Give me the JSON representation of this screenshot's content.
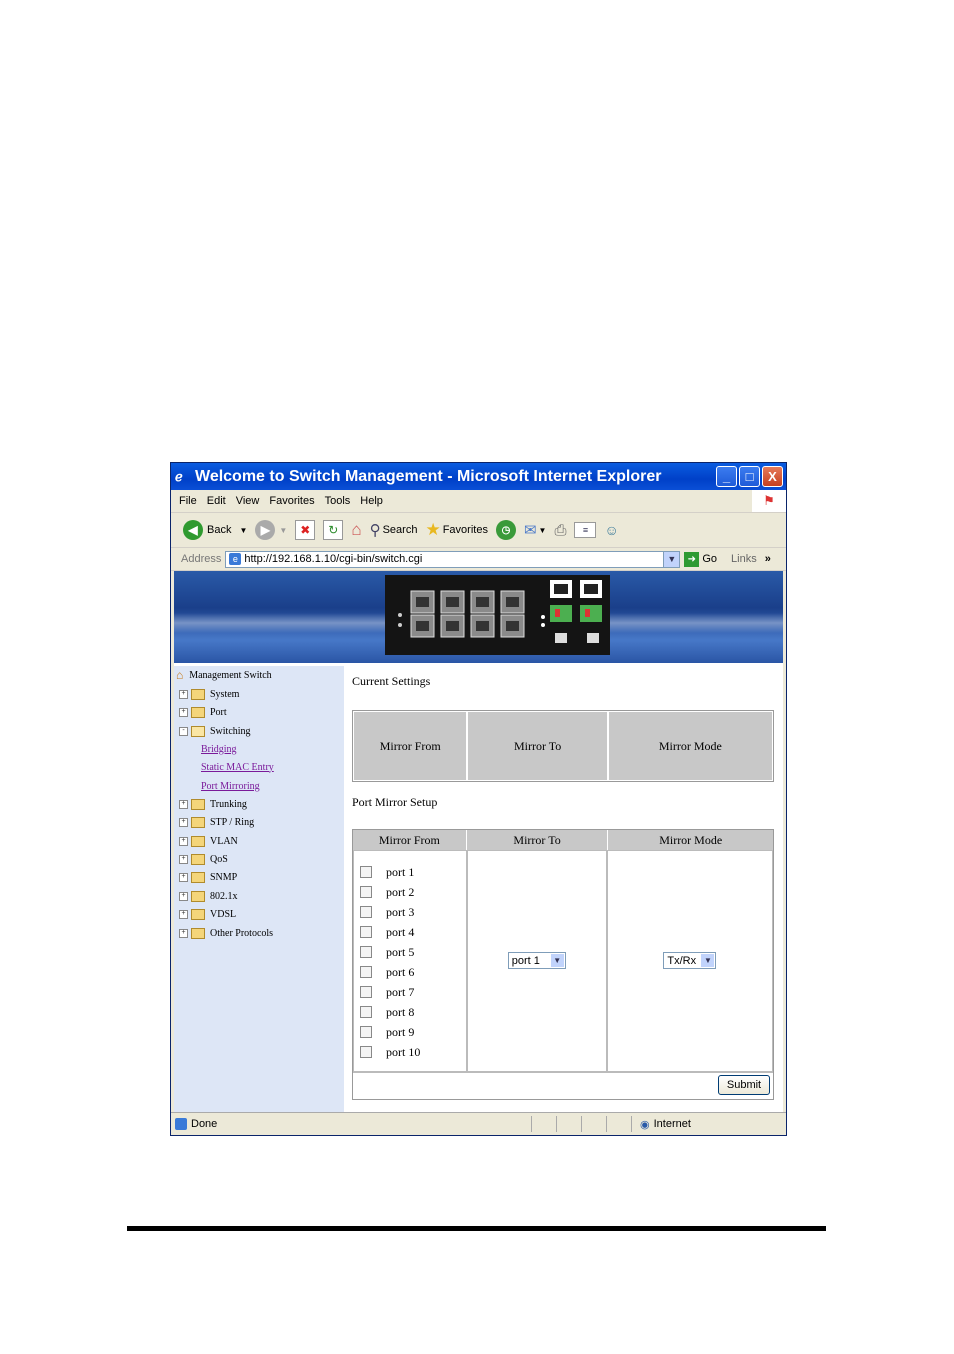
{
  "window": {
    "title": "Welcome to Switch Management - Microsoft Internet Explorer",
    "controls": {
      "minimize": "_",
      "maximize": "□",
      "close": "X"
    }
  },
  "menu": [
    "File",
    "Edit",
    "View",
    "Favorites",
    "Tools",
    "Help"
  ],
  "toolbar": {
    "back": "Back",
    "search": "Search",
    "favorites": "Favorites"
  },
  "address": {
    "label": "Address",
    "url": "http://192.168.1.10/cgi-bin/switch.cgi",
    "go": "Go",
    "links": "Links"
  },
  "sidebar": {
    "root": "Management Switch",
    "items": [
      {
        "label": "System",
        "expander": "+"
      },
      {
        "label": "Port",
        "expander": "+"
      },
      {
        "label": "Switching",
        "expander": "-"
      },
      {
        "label": "Trunking",
        "expander": "+"
      },
      {
        "label": "STP / Ring",
        "expander": "+"
      },
      {
        "label": "VLAN",
        "expander": "+"
      },
      {
        "label": "QoS",
        "expander": "+"
      },
      {
        "label": "SNMP",
        "expander": "+"
      },
      {
        "label": "802.1x",
        "expander": "+"
      },
      {
        "label": "VDSL",
        "expander": "+"
      },
      {
        "label": "Other Protocols",
        "expander": "+"
      }
    ],
    "switching_children": [
      "Bridging",
      "Static MAC Entry",
      "Port Mirroring"
    ]
  },
  "main": {
    "current_settings_title": "Current Settings",
    "columns": [
      "Mirror From",
      "Mirror To",
      "Mirror Mode"
    ],
    "port_mirror_setup_title": "Port Mirror Setup",
    "ports": [
      "port 1",
      "port 2",
      "port 3",
      "port 4",
      "port 5",
      "port 6",
      "port 7",
      "port 8",
      "port 9",
      "port 10"
    ],
    "mirror_to_value": "port 1",
    "mirror_mode_value": "Tx/Rx",
    "submit": "Submit"
  },
  "status": {
    "left": "Done",
    "zone": "Internet"
  }
}
